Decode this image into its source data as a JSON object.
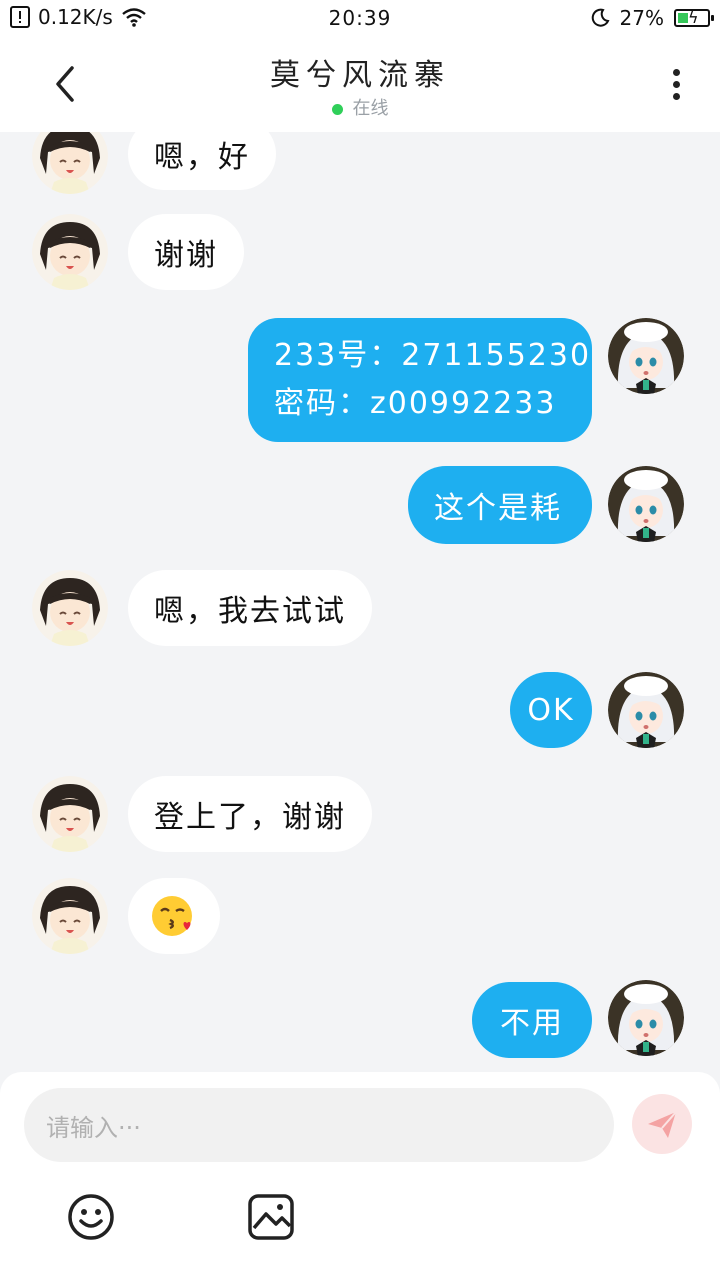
{
  "status_bar": {
    "speed": "0.12K/s",
    "time": "20:39",
    "battery": "27%"
  },
  "header": {
    "title": "莫兮风流寨",
    "status": "在线"
  },
  "messages": [
    {
      "side": "left",
      "text": "嗯，好"
    },
    {
      "side": "left",
      "text": "谢谢"
    },
    {
      "side": "right",
      "line1": "233号：271155230",
      "line2": "密码：z00992233"
    },
    {
      "side": "right",
      "text": "这个是耗"
    },
    {
      "side": "left",
      "text": "嗯，我去试试"
    },
    {
      "side": "right",
      "text": "OK"
    },
    {
      "side": "left",
      "text": "登上了，谢谢"
    },
    {
      "side": "left",
      "text": "😘"
    },
    {
      "side": "right",
      "text": "不用"
    }
  ],
  "input": {
    "placeholder": "请输入···"
  },
  "icons": [
    "back-icon",
    "more-icon",
    "send-icon",
    "emoji-icon",
    "image-icon"
  ],
  "colors": {
    "accent": "#1eaff0",
    "online": "#2fcf59",
    "send": "#f28c8c"
  }
}
